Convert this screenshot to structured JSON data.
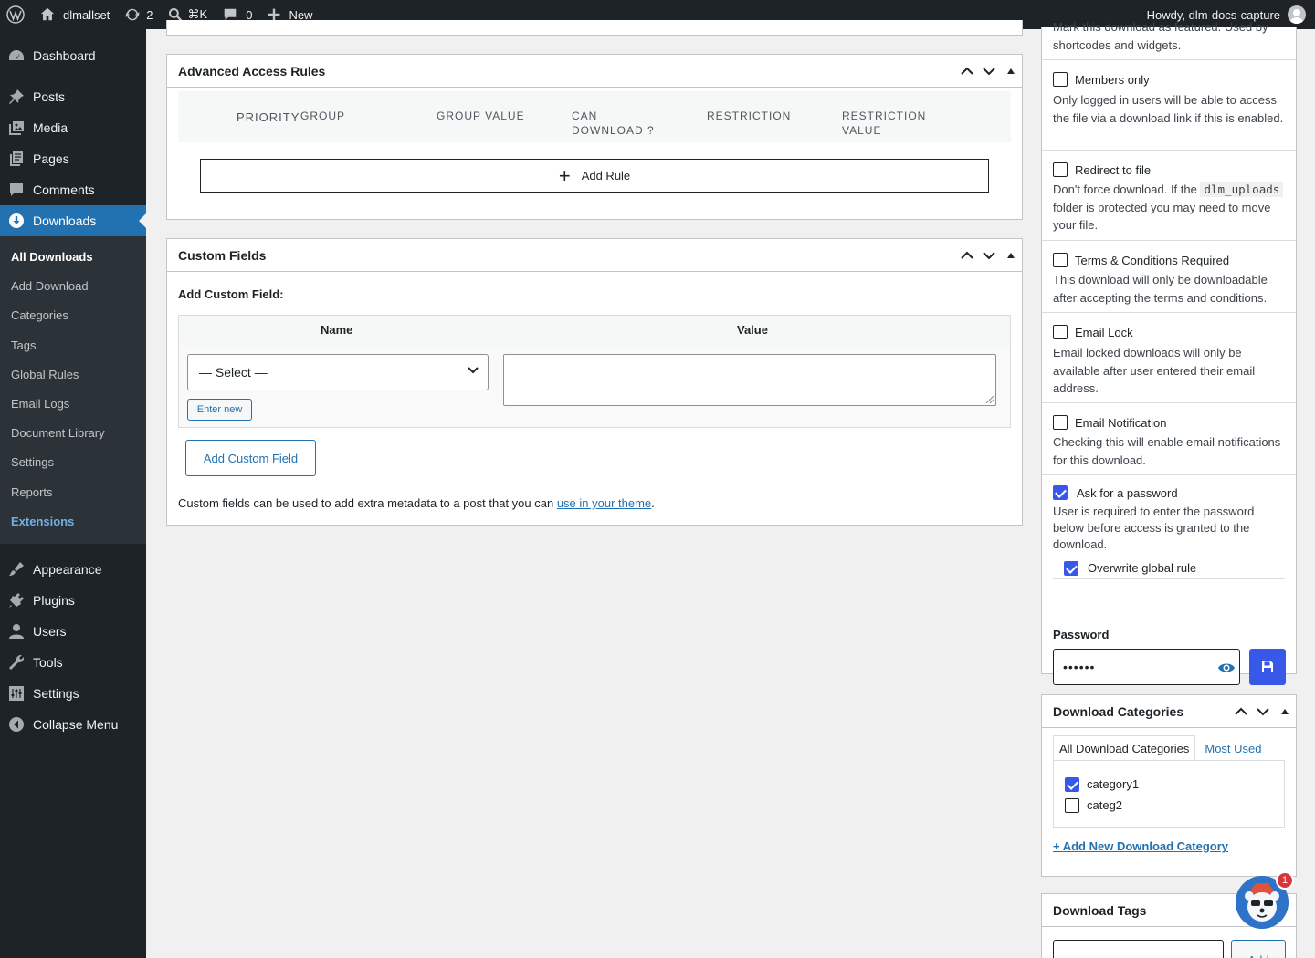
{
  "adminbar": {
    "site_name": "dlmallset",
    "updates_count": "2",
    "search_shortcut": "⌘K",
    "comments_count": "0",
    "new_label": "New",
    "howdy": "Howdy, dlm-docs-capture"
  },
  "sidebar": {
    "items_top": [
      {
        "label": "Dashboard",
        "icon": "dashboard-icon"
      },
      {
        "label": "Posts",
        "icon": "pin-icon"
      },
      {
        "label": "Media",
        "icon": "media-icon"
      },
      {
        "label": "Pages",
        "icon": "pages-icon"
      },
      {
        "label": "Comments",
        "icon": "comment-icon"
      },
      {
        "label": "Downloads",
        "icon": "download-icon"
      }
    ],
    "submenu": [
      "All Downloads",
      "Add Download",
      "Categories",
      "Tags",
      "Global Rules",
      "Email Logs",
      "Document Library",
      "Settings",
      "Reports",
      "Extensions"
    ],
    "items_bottom": [
      {
        "label": "Appearance",
        "icon": "brush-icon"
      },
      {
        "label": "Plugins",
        "icon": "plugin-icon"
      },
      {
        "label": "Users",
        "icon": "user-icon"
      },
      {
        "label": "Tools",
        "icon": "wrench-icon"
      },
      {
        "label": "Settings",
        "icon": "settings-icon"
      },
      {
        "label": "Collapse Menu",
        "icon": "collapse-icon"
      }
    ]
  },
  "access_rules": {
    "title": "Advanced Access Rules",
    "columns": [
      "PRIORITY",
      "GROUP",
      "GROUP VALUE",
      "CAN",
      "DOWNLOAD ?",
      "RESTRICTION",
      "RESTRICTION",
      "VALUE"
    ],
    "add_rule": "Add Rule"
  },
  "custom_fields": {
    "title": "Custom Fields",
    "add_label": "Add Custom Field:",
    "col_name": "Name",
    "col_value": "Value",
    "select_value": "— Select —",
    "enter_new": "Enter new",
    "add_button": "Add Custom Field",
    "note_prefix": "Custom fields can be used to add extra metadata to a post that you can ",
    "note_link": "use in your theme",
    "note_suffix": "."
  },
  "options": {
    "featured_partial": "Mark this download as featured. Used by",
    "featured_desc2": "shortcodes and widgets.",
    "members_only": {
      "label": "Members only",
      "desc": "Only logged in users will be able to access the file via a download link if this is enabled."
    },
    "redirect": {
      "label": "Redirect to file",
      "desc1": "Don't force download. If the",
      "code": "dlm_uploads",
      "desc2": "folder is protected you may need to move your file."
    },
    "terms": {
      "label": "Terms & Conditions Required",
      "desc": "This download will only be downloadable after accepting the terms and conditions."
    },
    "email_lock": {
      "label": "Email Lock",
      "desc": "Email locked downloads will only be available after user entered their email address."
    },
    "email_notification": {
      "label": "Email Notification",
      "desc": "Checking this will enable email notifications for this download."
    },
    "password": {
      "label": "Ask for a password",
      "desc": "User is required to enter the password below before access is granted to the download.",
      "overwrite": "Overwrite global rule"
    },
    "password_field_label": "Password",
    "password_value": "••••••"
  },
  "categories": {
    "title": "Download Categories",
    "tab_all": "All Download Categories",
    "tab_used": "Most Used",
    "items": [
      {
        "label": "category1",
        "checked": true
      },
      {
        "label": "categ2",
        "checked": false
      }
    ],
    "add_new": "+ Add New Download Category"
  },
  "tags": {
    "title": "Download Tags",
    "add": "Add"
  },
  "notifications_badge": "1",
  "colors": {
    "accent": "#2271b1",
    "checkbox": "#3858e9",
    "adminbar": "#1d2327"
  }
}
